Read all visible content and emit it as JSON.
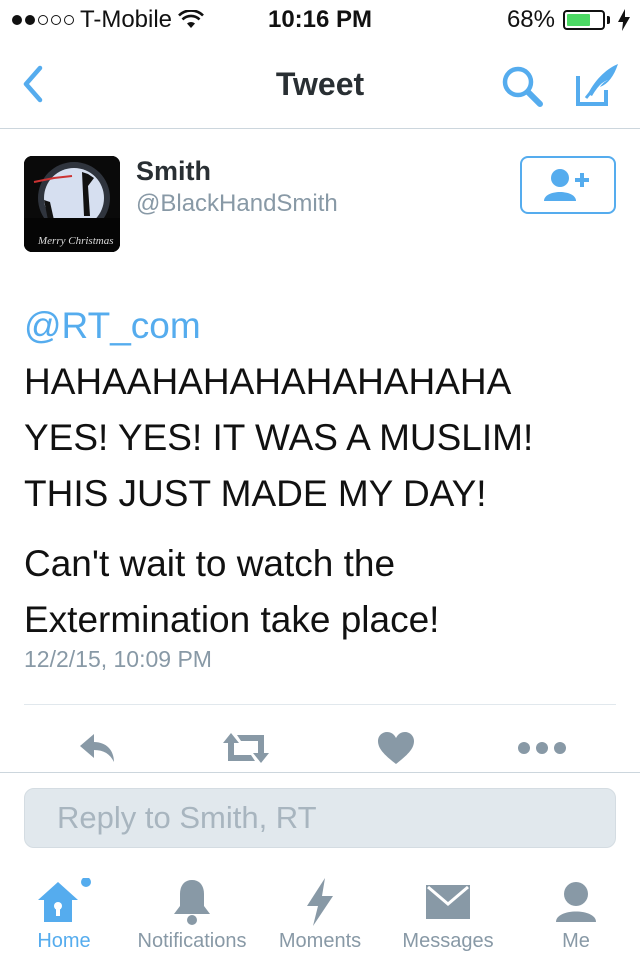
{
  "status_bar": {
    "carrier": "T-Mobile",
    "time": "10:16 PM",
    "battery_percent": "68%",
    "battery_level": 0.68,
    "signal_bars_filled": 2,
    "signal_bars_total": 5
  },
  "nav": {
    "title": "Tweet",
    "back_icon": "chevron-left-icon",
    "search_icon": "search-icon",
    "compose_icon": "compose-icon"
  },
  "tweet": {
    "author_name": "Smith",
    "author_handle": "@BlackHandSmith",
    "avatar_caption": "Merry Christmas",
    "mention": "@RT_com",
    "lines": [
      "HAHAAHAHAHAHAHAHAHA",
      "YES! YES! IT WAS A MUSLIM!",
      "THIS JUST MADE MY DAY!"
    ],
    "lines2": [
      "Can't wait to watch the",
      "Extermination take place!"
    ],
    "timestamp": "12/2/15, 10:09 PM"
  },
  "actions": [
    "reply-icon",
    "retweet-icon",
    "like-icon",
    "more-icon"
  ],
  "reply_box": {
    "placeholder": "Reply to Smith, RT"
  },
  "tab_bar": {
    "tabs": [
      {
        "label": "Home",
        "icon": "home-icon",
        "active": true
      },
      {
        "label": "Notifications",
        "icon": "bell-icon",
        "active": false
      },
      {
        "label": "Moments",
        "icon": "lightning-icon",
        "active": false
      },
      {
        "label": "Messages",
        "icon": "envelope-icon",
        "active": false
      },
      {
        "label": "Me",
        "icon": "person-icon",
        "active": false
      }
    ]
  },
  "colors": {
    "accent": "#55acee",
    "muted": "#8899a6",
    "battery_green": "#4cd964"
  }
}
